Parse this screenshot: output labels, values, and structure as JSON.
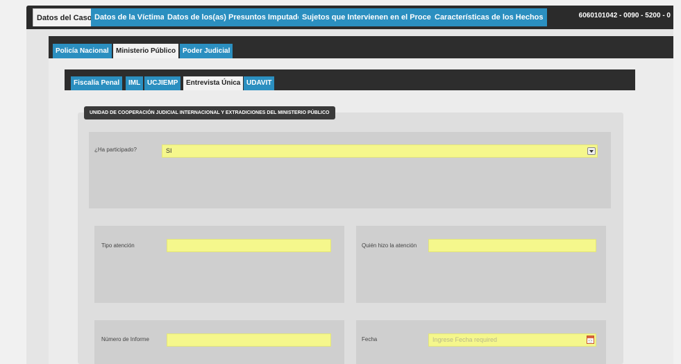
{
  "top_tabs": [
    {
      "label": "Datos del Caso"
    },
    {
      "label": "Datos de la Víctima"
    },
    {
      "label": "Datos de los(as) Presuntos Imputados"
    },
    {
      "label": "Sujetos que Intervienen en el Proceso"
    },
    {
      "label": "Características de los Hechos"
    }
  ],
  "case_id": "6060101042 - 0090 - 5200 - 0",
  "institution_tabs": [
    {
      "label": "Policía Nacional"
    },
    {
      "label": "Ministerio Público"
    },
    {
      "label": "Poder Judicial"
    }
  ],
  "mp_tabs": [
    {
      "label": "Fiscalía Penal"
    },
    {
      "label": "IML"
    },
    {
      "label": "UCJIEMP"
    },
    {
      "label": "Entrevista Única"
    },
    {
      "label": "UDAVIT"
    }
  ],
  "section_title": "UNIDAD DE COOPERACIÓN JUDICIAL INTERNACIONAL Y EXTRADICIONES DEL MINISTERIO PÚBLICO",
  "form": {
    "participated": {
      "label": "¿Ha participado?",
      "value": "SI"
    },
    "attention_type": {
      "label": "Tipo atención",
      "value": ""
    },
    "attended_by": {
      "label": "Quién hizo la atención",
      "value": ""
    },
    "report_number": {
      "label": "Número de Informe",
      "value": ""
    },
    "date": {
      "label": "Fecha",
      "placeholder": "Ingrese Fecha required"
    }
  },
  "colors": {
    "tab_blue": "#2b8fc0",
    "field_yellow": "#f5f78c",
    "bar_dark": "#2d2d2d"
  }
}
